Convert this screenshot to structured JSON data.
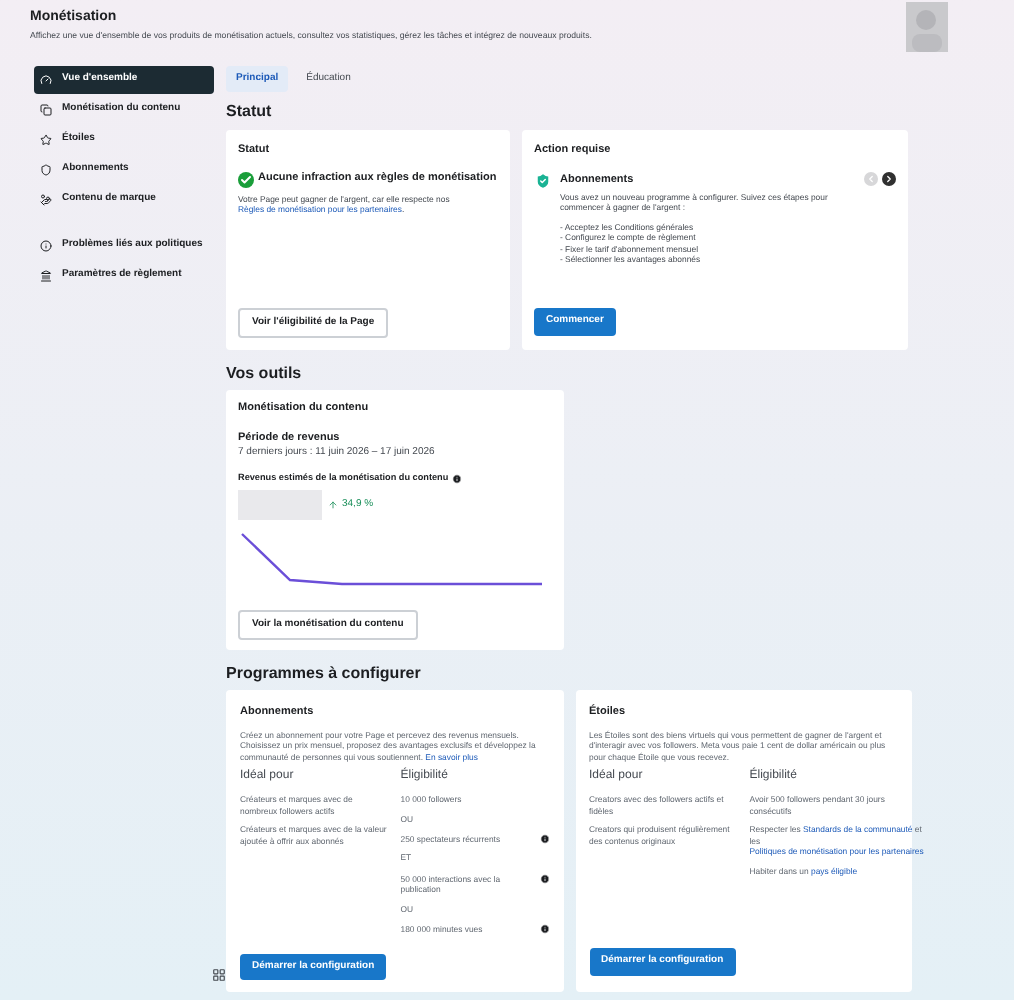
{
  "header": {
    "title": "Monétisation",
    "subtitle": "Affichez une vue d'ensemble de vos produits de monétisation actuels, consultez vos statistiques, gérez les tâches et intégrez de nouveaux produits."
  },
  "sidebar": {
    "sections": [
      [
        {
          "label": "Vue d'ensemble",
          "kind": "gauge",
          "selected": true
        },
        {
          "label": "Monétisation du contenu",
          "kind": "copy",
          "selected": false
        },
        {
          "label": "Étoiles",
          "kind": "star",
          "selected": false
        },
        {
          "label": "Abonnements",
          "kind": "shield",
          "selected": false
        },
        {
          "label": "Contenu de marque",
          "kind": "hand",
          "selected": false
        }
      ],
      [
        {
          "label": "Problèmes liés aux politiques",
          "kind": "info",
          "selected": false
        },
        {
          "label": "Paramètres de règlement",
          "kind": "bank",
          "selected": false
        }
      ]
    ]
  },
  "tabs": [
    {
      "label": "Principal",
      "selected": true
    },
    {
      "label": "Éducation",
      "selected": false
    }
  ],
  "status_section": {
    "heading": "Statut",
    "status_card": {
      "heading": "Statut",
      "title": "Aucune infraction aux règles de monétisation",
      "body": "Votre Page peut gagner de l'argent, car elle respecte nos",
      "link": "Règles de monétisation pour les partenaires",
      "body_end": ".",
      "button": "Voir l'éligibilité de la Page"
    },
    "action_card": {
      "heading": "Action requise",
      "title": "Abonnements",
      "body": "Vous avez un nouveau programme à configurer. Suivez ces étapes pour commencer à gagner de l'argent :",
      "steps": [
        "- Acceptez les Conditions générales",
        "- Configurez le compte de règlement",
        "- Fixer le tarif d'abonnement mensuel",
        "- Sélectionner les avantages abonnés"
      ],
      "prev_disabled": true,
      "next_disabled": false,
      "button": "Commencer"
    }
  },
  "tools": {
    "heading": "Vos outils",
    "card": {
      "title": "Monétisation du contenu",
      "period_label": "Période de revenus",
      "period": "7 derniers jours : 11 juin 2026 – 17 juin 2026",
      "revenue_label": "Revenus estimés de la monétisation du contenu",
      "change": "34,9 %",
      "button": "Voir la monétisation du contenu"
    }
  },
  "programs": {
    "heading": "Programmes à configurer",
    "cards": [
      {
        "title": "Abonnements",
        "description": [
          {
            "text": "Créez un abonnement pour votre Page et percevez des revenus mensuels. Choisissez un prix mensuel, proposez des avantages exclusifs et développez la communauté de personnes qui vous soutiennent. "
          },
          {
            "text": "En savoir plus",
            "link": true
          }
        ],
        "ideal_label": "Idéal pour",
        "ideal": [
          "Créateurs et marques avec de nombreux followers actifs",
          "Créateurs et marques avec de la valeur ajoutée à offrir aux abonnés"
        ],
        "eligibility_label": "Éligibilité",
        "eligibility": [
          {
            "kind": "criterion",
            "parts": [
              {
                "text": "10 000 followers"
              }
            ],
            "info": false
          },
          {
            "kind": "connector",
            "parts": [
              {
                "text": "OU"
              }
            ],
            "info": false
          },
          {
            "kind": "criterion",
            "parts": [
              {
                "text": "250 spectateurs récurrents"
              }
            ],
            "info": true
          },
          {
            "kind": "connector",
            "parts": [
              {
                "text": "ET"
              }
            ],
            "info": false
          },
          {
            "kind": "criterion",
            "parts": [
              {
                "text": "50 000 interactions avec la publication"
              }
            ],
            "info": true
          },
          {
            "kind": "connector",
            "parts": [
              {
                "text": "OU"
              }
            ],
            "info": false
          },
          {
            "kind": "criterion",
            "parts": [
              {
                "text": "180 000 minutes vues"
              }
            ],
            "info": true
          }
        ],
        "button": "Démarrer la configuration"
      },
      {
        "title": "Étoiles",
        "description": [
          {
            "text": "Les Étoiles sont des biens virtuels qui vous permettent de gagner de l'argent et d'interagir avec vos followers. Meta vous paie 1 cent de dollar américain ou plus pour chaque Étoile que vous recevez."
          }
        ],
        "ideal_label": "Idéal pour",
        "ideal": [
          "Creators avec des followers actifs et fidèles",
          "Creators qui produisent régulièrement des contenus originaux"
        ],
        "eligibility_label": "Éligibilité",
        "eligibility": [
          {
            "kind": "criterion",
            "parts": [
              {
                "text": "Avoir 500 followers pendant 30 jours consécutifs"
              }
            ],
            "info": false
          },
          {
            "kind": "criterion",
            "parts": [
              {
                "text": "Respecter les "
              },
              {
                "text": "Standards de la communauté",
                "link": true
              },
              {
                "text": " et les "
              },
              {
                "text": "Politiques de monétisation pour les partenaires",
                "link": true
              }
            ],
            "info": false
          },
          {
            "kind": "criterion",
            "parts": [
              {
                "text": "Habiter dans un "
              },
              {
                "text": "pays éligible",
                "link": true
              }
            ],
            "info": false
          }
        ],
        "button": "Démarrer la configuration"
      }
    ]
  }
}
